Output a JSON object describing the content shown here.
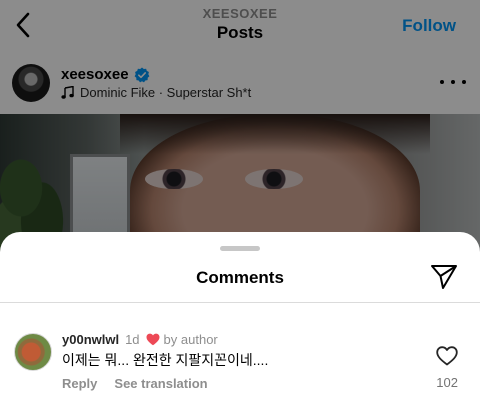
{
  "header": {
    "username": "XEESOXEE",
    "title": "Posts",
    "follow_label": "Follow"
  },
  "post": {
    "author": "xeesoxee",
    "music": "Dominic Fike · Superstar Sh*t"
  },
  "comments_sheet": {
    "title": "Comments"
  },
  "comments": [
    {
      "username": "y00nwlwl",
      "time": "1d",
      "by_author": "by author",
      "text": "이제는 뭐... 완전한 지팔지꼰이네....",
      "reply_label": "Reply",
      "translation_label": "See translation",
      "like_count": "102"
    }
  ],
  "colors": {
    "accent_blue": "#0095f6",
    "like_red": "#ed4956",
    "overlay": "rgba(0,0,0,0.45)"
  },
  "icons": {
    "back": "chevron-left-icon",
    "verified": "verified-badge-icon",
    "music": "music-note-icon",
    "more": "more-horizontal-icon",
    "share": "paper-plane-icon",
    "heart": "heart-icon"
  }
}
